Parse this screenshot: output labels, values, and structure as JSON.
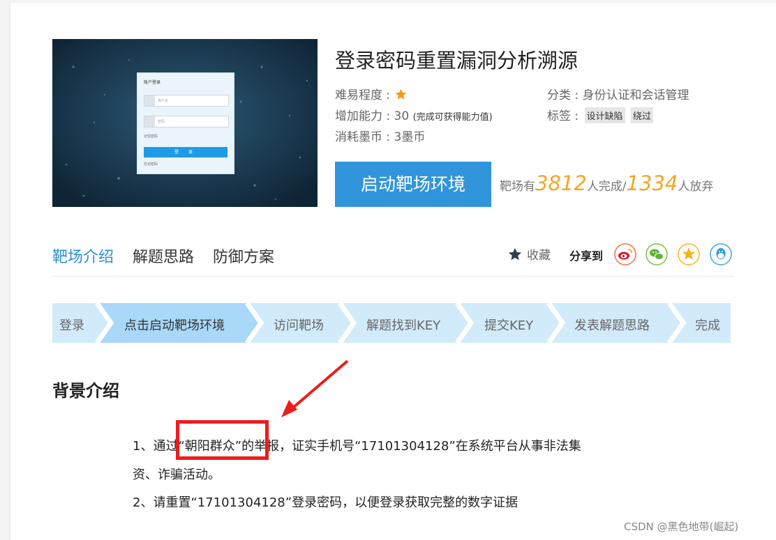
{
  "cover": {
    "login_title": "账户登录",
    "username_placeholder": "用户名",
    "password_placeholder": "密码",
    "remember_label": "记住密码",
    "login_button": "登 录",
    "forgot_label": "忘记密码"
  },
  "lab": {
    "title": "登录密码重置漏洞分析溯源",
    "difficulty_label": "难易程度 :",
    "difficulty_stars": 1,
    "ability_label": "增加能力 : 30",
    "ability_note": "(完成可获得能力值)",
    "cost_label": "消耗墨币 : 3墨币",
    "category_label": "分类 : 身份认证和会话管理",
    "tags_label": "标签 :",
    "tags": [
      "设计缺陷",
      "绕过"
    ],
    "start_button": "启动靶场环境",
    "stats": {
      "prefix": "靶场有",
      "completed": "3812",
      "completed_suffix": "人完成/",
      "abandoned": "1334",
      "abandoned_suffix": "人放弃"
    }
  },
  "tabs": [
    {
      "label": "靶场介绍",
      "active": true
    },
    {
      "label": "解题思路",
      "active": false
    },
    {
      "label": "防御方案",
      "active": false
    }
  ],
  "collect_label": "收藏",
  "share_label": "分享到",
  "share_icons": [
    "weibo-icon",
    "wechat-icon",
    "qzone-icon",
    "qq-icon"
  ],
  "steps": [
    {
      "label": "登录",
      "active": false
    },
    {
      "label": "点击启动靶场环境",
      "active": true
    },
    {
      "label": "访问靶场",
      "active": false
    },
    {
      "label": "解题找到KEY",
      "active": false
    },
    {
      "label": "提交KEY",
      "active": false
    },
    {
      "label": "发表解题思路",
      "active": false
    },
    {
      "label": "完成",
      "active": false
    }
  ],
  "article": {
    "section_title": "背景介绍",
    "para1_line1": "1、通过“朝阳群众”的举报，证实手机号“17101304128”在系统平台从事非法集",
    "para1_line2": "资、诈骗活动。",
    "para2": "2、请重置“17101304128”登录密码，以便登录获取完整的数字证据"
  },
  "watermark": "CSDN @黑色地带(崛起)",
  "colors": {
    "primary": "#3095da",
    "active_tab": "#2a8dd8",
    "stat_number": "#f5a623",
    "step_bg": "#d2ebfb",
    "step_active_bg": "#a9d8f8",
    "annotation_red": "#ee1c1c"
  }
}
